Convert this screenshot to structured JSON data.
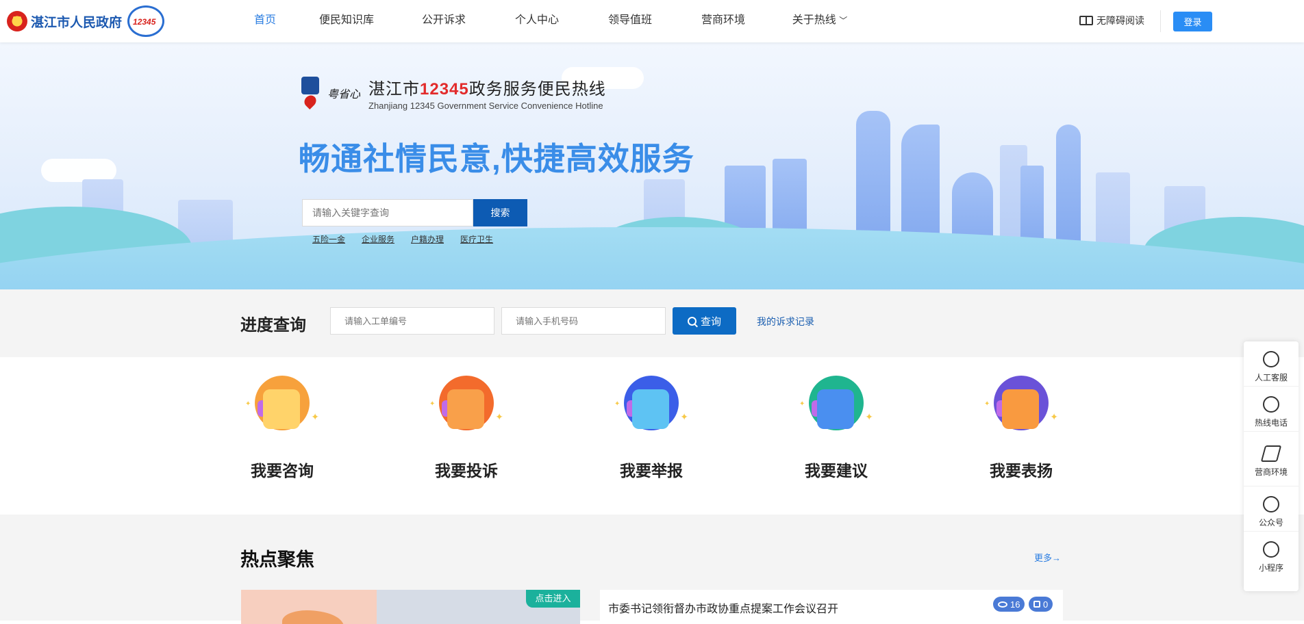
{
  "header": {
    "logo_text": "湛江市人民政府",
    "badge_text": "12345",
    "nav": [
      {
        "label": "首页",
        "active": true
      },
      {
        "label": "便民知识库"
      },
      {
        "label": "公开诉求"
      },
      {
        "label": "个人中心"
      },
      {
        "label": "领导值班"
      },
      {
        "label": "营商环境"
      },
      {
        "label": "关于热线"
      }
    ],
    "nav_dropdown_glyph": "﹀",
    "accessibility": "无障碍阅读",
    "login": "登录"
  },
  "banner": {
    "mascot_text": "粤省心",
    "title_prefix": "湛江市",
    "title_number": "12345",
    "title_suffix": "政务服务便民热线",
    "title_en": "Zhanjiang 12345 Government Service Convenience Hotline",
    "slogan": "畅通社情民意,快捷高效服务",
    "search_placeholder": "请输入关键字查询",
    "search_button": "搜索",
    "hot_links": [
      "五险一金",
      "企业服务",
      "户籍办理",
      "医疗卫生"
    ]
  },
  "progress": {
    "title": "进度查询",
    "order_placeholder": "请输入工单编号",
    "phone_placeholder": "请输入手机号码",
    "button": "查询",
    "record_link": "我的诉求记录"
  },
  "services": [
    {
      "label": "我要咨询",
      "icon": "consult-icon",
      "color": "#f7a13c",
      "card": "#ffd36a"
    },
    {
      "label": "我要投诉",
      "icon": "complaint-icon",
      "color": "#f36b2c",
      "card": "#f9a04a"
    },
    {
      "label": "我要举报",
      "icon": "report-icon",
      "color": "#3b5ee8",
      "card": "#5ec3f3"
    },
    {
      "label": "我要建议",
      "icon": "suggest-icon",
      "color": "#1fb58f",
      "card": "#4a8ff0"
    },
    {
      "label": "我要表扬",
      "icon": "praise-icon",
      "color": "#6a52d8",
      "card": "#f99a40"
    }
  ],
  "hot": {
    "title": "热点聚焦",
    "more": "更多→",
    "enter_tag": "点击进入",
    "news_title": "市委书记领衔督办市政协重点提案工作会议召开",
    "views": "16",
    "likes": "0"
  },
  "side_panel": [
    {
      "label": "人工客服",
      "icon": "headset-icon"
    },
    {
      "label": "热线电话",
      "icon": "phone-icon"
    },
    {
      "label": "营商环境",
      "icon": "envelope-icon"
    },
    {
      "label": "公众号",
      "icon": "wechat-icon"
    },
    {
      "label": "小程序",
      "icon": "miniprogram-icon"
    }
  ]
}
